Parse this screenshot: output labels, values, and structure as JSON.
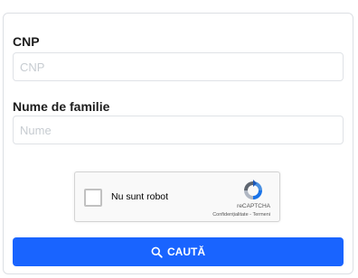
{
  "form": {
    "cnp_label": "CNP",
    "cnp_placeholder": "CNP",
    "cnp_value": "",
    "surname_label": "Nume de familie",
    "surname_placeholder": "Nume",
    "surname_value": ""
  },
  "recaptcha": {
    "label": "Nu sunt robot",
    "brand": "reCAPTCHA",
    "privacy": "Confidențialitate",
    "separator": " - ",
    "terms": "Termeni",
    "icon": "recaptcha-logo"
  },
  "search_button": {
    "label": "CAUTĂ",
    "icon": "search-icon",
    "color": "#1964ff"
  }
}
